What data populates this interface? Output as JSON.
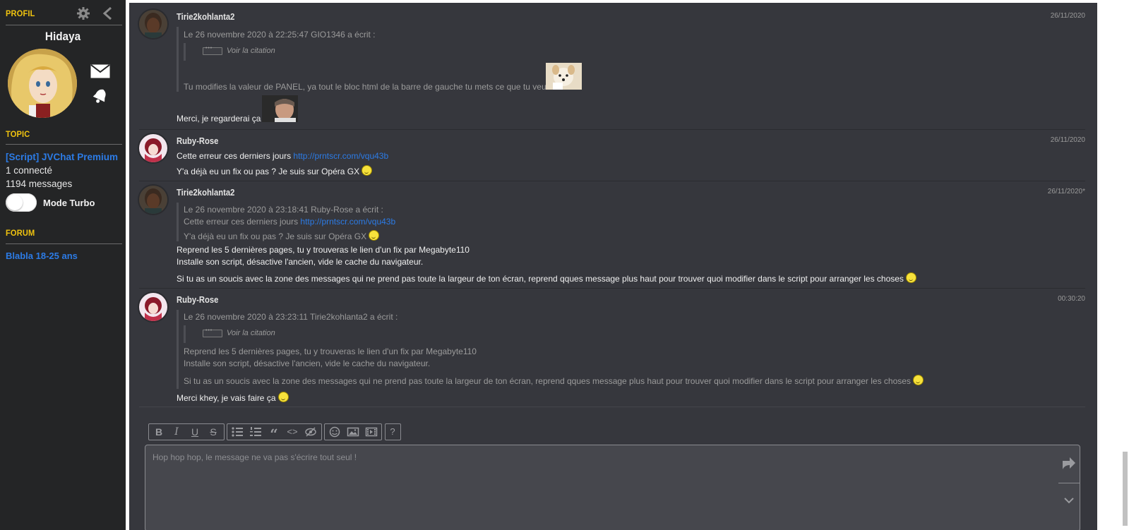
{
  "sidebar": {
    "profile_title": "PROFIL",
    "username": "Hidaya",
    "topic_title": "TOPIC",
    "topic_name": "[Script] JVChat Premium",
    "connected": "1 connecté",
    "messages": "1194 messages",
    "turbo_label": "Mode Turbo",
    "forum_title": "FORUM",
    "forum_name": "Blabla 18-25 ans"
  },
  "messages": [
    {
      "author": "Tirie2kohlanta2",
      "date": "26/11/2020",
      "quote_header": "Le 26 novembre 2020 à 22:25:47 GIO1346 a écrit :",
      "cite_label": "Voir la citation",
      "quote_text": "Tu modifies la valeur de PANEL, ya tout le bloc html de la barre de gauche tu mets ce que tu veux",
      "body": "Merci, je regarderai ça"
    },
    {
      "author": "Ruby-Rose",
      "date": "26/11/2020",
      "line1": "Cette erreur ces derniers jours",
      "link": "http://prntscr.com/vqu43b",
      "line2": "Y'a déjà eu un fix ou pas ? Je suis sur Opéra GX"
    },
    {
      "author": "Tirie2kohlanta2",
      "date": "26/11/2020*",
      "quote_header": "Le 26 novembre 2020 à 23:18:41 Ruby-Rose a écrit :",
      "quote_line1": "Cette erreur ces derniers jours",
      "quote_link": "http://prntscr.com/vqu43b",
      "quote_line2": "Y'a déjà eu un fix ou pas ? Je suis sur Opéra GX",
      "body1": "Reprend les 5 dernières pages, tu y trouveras le lien d'un fix par Megabyte110",
      "body2": "Installe son script, désactive l'ancien, vide le cache du navigateur.",
      "body3": "Si tu as un soucis avec la zone des messages qui ne prend pas toute la largeur de ton écran, reprend qques message plus haut pour trouver quoi modifier dans le script pour arranger les choses"
    },
    {
      "author": "Ruby-Rose",
      "date": "00:30:20",
      "quote_header": "Le 26 novembre 2020 à 23:23:11 Tirie2kohlanta2 a écrit :",
      "cite_label": "Voir la citation",
      "quote_line1": "Reprend les 5 dernières pages, tu y trouveras le lien d'un fix par Megabyte110",
      "quote_line2": "Installe son script, désactive l'ancien, vide le cache du navigateur.",
      "quote_line3": "Si tu as un soucis avec la zone des messages qui ne prend pas toute la largeur de ton écran, reprend qques message plus haut pour trouver quoi modifier dans le script pour arranger les choses",
      "body": "Merci khey, je vais faire ça"
    }
  ],
  "editor": {
    "placeholder": "Hop hop hop, le message ne va pas s'écrire tout seul !",
    "help": "?"
  },
  "icons": {
    "settings": "gear-icon",
    "collapse": "chevron-left-icon",
    "mail": "mail-icon",
    "bell": "bell-icon",
    "send": "send-icon",
    "expand": "chevron-down-icon"
  },
  "colors": {
    "accent": "#f1c40f",
    "link": "#2c7be5",
    "background": "#36373d",
    "sidebar": "#242526"
  }
}
